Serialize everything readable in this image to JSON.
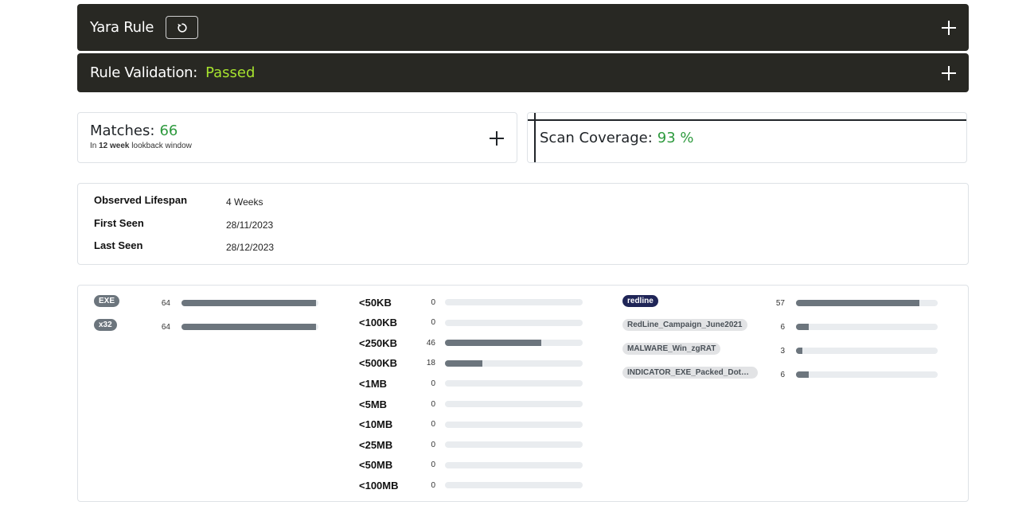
{
  "yara_panel": {
    "title": "Yara Rule"
  },
  "validation_panel": {
    "label": "Rule Validation:",
    "status": "Passed"
  },
  "matches": {
    "label": "Matches:",
    "value": "66",
    "sub_prefix": "In",
    "sub_bold": "12 week",
    "sub_suffix": "lookback window"
  },
  "coverage": {
    "label": "Scan Coverage:",
    "value": "93 %"
  },
  "lifespan": {
    "rows": [
      {
        "key": "Observed Lifespan",
        "value": "4 Weeks"
      },
      {
        "key": "First Seen",
        "value": "28/11/2023"
      },
      {
        "key": "Last Seen",
        "value": "28/12/2023"
      }
    ]
  },
  "filetypes": [
    {
      "label": "EXE",
      "count": "64",
      "fraction": 0.98
    },
    {
      "label": "x32",
      "count": "64",
      "fraction": 0.98
    }
  ],
  "sizes": [
    {
      "label": "<50KB",
      "count": "0",
      "fraction": 0
    },
    {
      "label": "<100KB",
      "count": "0",
      "fraction": 0
    },
    {
      "label": "<250KB",
      "count": "46",
      "fraction": 0.7
    },
    {
      "label": "<500KB",
      "count": "18",
      "fraction": 0.27
    },
    {
      "label": "<1MB",
      "count": "0",
      "fraction": 0
    },
    {
      "label": "<5MB",
      "count": "0",
      "fraction": 0
    },
    {
      "label": "<10MB",
      "count": "0",
      "fraction": 0
    },
    {
      "label": "<25MB",
      "count": "0",
      "fraction": 0
    },
    {
      "label": "<50MB",
      "count": "0",
      "fraction": 0
    },
    {
      "label": "<100MB",
      "count": "0",
      "fraction": 0
    }
  ],
  "tags": [
    {
      "label": "redline",
      "count": "57",
      "fraction": 0.87,
      "style": "dark"
    },
    {
      "label": "RedLine_Campaign_June2021",
      "count": "6",
      "fraction": 0.09,
      "style": "light"
    },
    {
      "label": "MALWARE_Win_zgRAT",
      "count": "3",
      "fraction": 0.045,
      "style": "light"
    },
    {
      "label": "INDICATOR_EXE_Packed_DotNe...",
      "count": "6",
      "fraction": 0.09,
      "style": "light"
    }
  ],
  "icons": {
    "reset": "reset-icon",
    "expand": "plus-icon"
  }
}
